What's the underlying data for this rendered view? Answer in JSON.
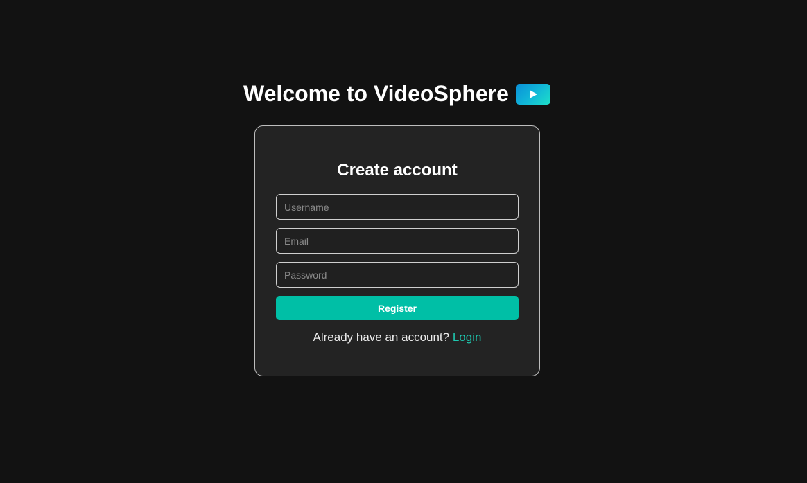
{
  "header": {
    "welcome_text": "Welcome to VideoSphere",
    "logo_icon": "play-icon"
  },
  "form": {
    "title": "Create account",
    "username_placeholder": "Username",
    "email_placeholder": "Email",
    "password_placeholder": "Password",
    "username_value": "",
    "email_value": "",
    "password_value": "",
    "register_label": "Register",
    "login_prompt": "Already have an account?",
    "login_link": "Login"
  },
  "colors": {
    "background": "#121212",
    "card_background": "#232323",
    "accent": "#00bfa6",
    "link": "#1ec8b0"
  }
}
